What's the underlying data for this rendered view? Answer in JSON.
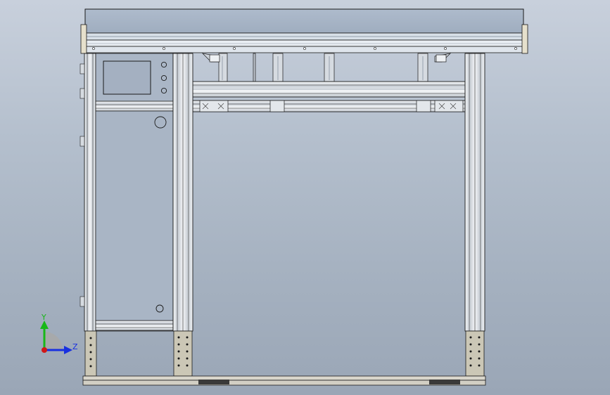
{
  "viewport": {
    "background_top": "#c8d0dc",
    "background_bottom": "#9aa6b6"
  },
  "model": {
    "line_color": "#1a1a1a",
    "frame_fill": "#d8dde3",
    "profile_slot": "#8e98a4",
    "foot_fill": "#c9c5b4",
    "rail_fill": "#dfe5ec",
    "hood_fill": "#a9b6c6",
    "panel_fill": "#aab6c6",
    "base_fill": "#d9d6cc",
    "dark_pad": "#3a3a3a"
  },
  "triad": {
    "y_label": "Y",
    "z_label": "Z",
    "x_color": "#d01818",
    "y_color": "#18b818",
    "z_color": "#1830e0"
  }
}
